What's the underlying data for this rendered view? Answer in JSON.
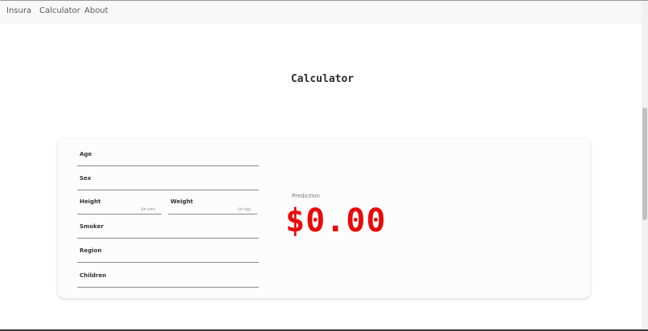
{
  "nav": {
    "brand": "Insura",
    "items": [
      {
        "label": "Calculator"
      },
      {
        "label": "About"
      }
    ]
  },
  "page": {
    "title": "Calculator"
  },
  "form": {
    "age_label": "Age",
    "sex_label": "Sex",
    "height_label": "Height",
    "height_unit": "(in cm)",
    "weight_label": "Weight",
    "weight_unit": "(in kg)",
    "smoker_label": "Smoker",
    "region_label": "Region",
    "children_label": "Children"
  },
  "prediction": {
    "label": "Prediction",
    "value": "$0.00",
    "value_color": "#e80a0a"
  }
}
